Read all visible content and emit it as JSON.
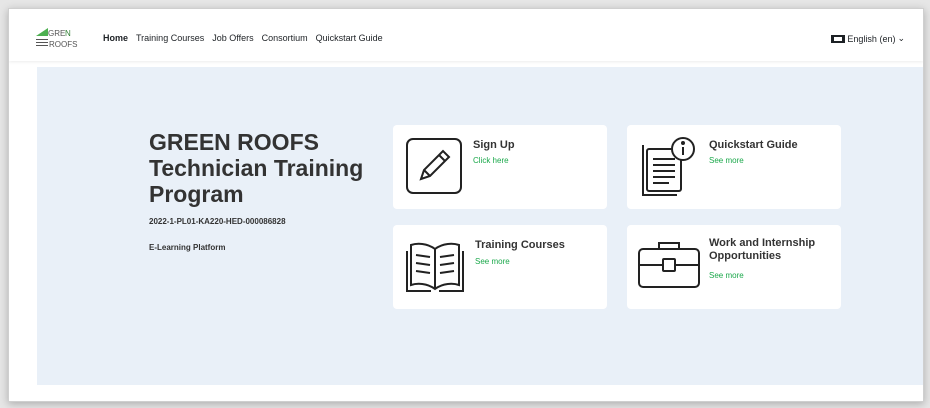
{
  "nav": {
    "logo_text": "GREEN ROOFS",
    "links": [
      "Home",
      "Training Courses",
      "Job Offers",
      "Consortium",
      "Quickstart Guide"
    ],
    "language": "English (en)"
  },
  "hero": {
    "title": "GREEN ROOFS Technician Training Program",
    "code": "2022-1-PL01-KA220-HED-000086828",
    "subtitle": "E-Learning Platform"
  },
  "cards": [
    {
      "title": "Sign Up",
      "link": "Click here",
      "icon": "pencil-icon"
    },
    {
      "title": "Quickstart Guide",
      "link": "See more",
      "icon": "document-info-icon"
    },
    {
      "title": "Training Courses",
      "link": "See more",
      "icon": "open-book-icon"
    },
    {
      "title": "Work and Internship Opportunities",
      "link": "See more",
      "icon": "briefcase-icon"
    }
  ],
  "colors": {
    "accent_green": "#1aa84a",
    "hero_bg": "#e9f0f8",
    "text": "#333333"
  }
}
